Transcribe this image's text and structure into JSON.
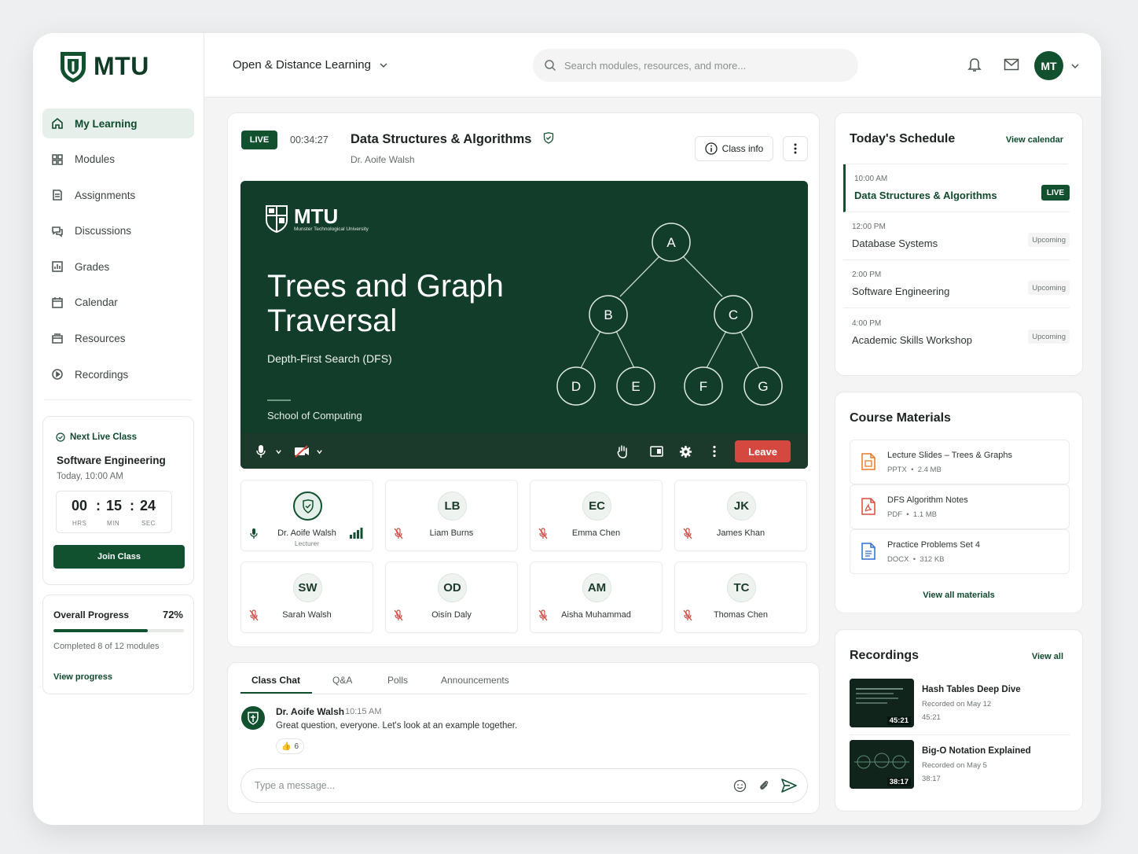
{
  "brand": {
    "name": "MTU"
  },
  "sidebar": {
    "items": [
      {
        "label": "My Learning",
        "icon": "home-icon"
      },
      {
        "label": "Modules",
        "icon": "grid-icon"
      },
      {
        "label": "Assignments",
        "icon": "assignment-icon"
      },
      {
        "label": "Discussions",
        "icon": "chat-bubbles-icon"
      },
      {
        "label": "Grades",
        "icon": "bar-chart-icon"
      },
      {
        "label": "Calendar",
        "icon": "calendar-icon"
      },
      {
        "label": "Resources",
        "icon": "folder-icon"
      },
      {
        "label": "Recordings",
        "icon": "play-circle-icon"
      }
    ],
    "next_live_class": {
      "heading": "Next Live Class",
      "title": "Software Engineering",
      "time": "Today, 10:00 AM",
      "countdown": {
        "hrs": "00",
        "min": "15",
        "sec": "24",
        "hrs_label": "HRS",
        "min_label": "MIN",
        "sec_label": "SEC"
      },
      "join_label": "Join Class"
    },
    "progress": {
      "title": "Overall Progress",
      "percent_label": "72%",
      "percent": 72,
      "subtitle": "Completed 8 of 12 modules",
      "link": "View progress"
    }
  },
  "header": {
    "program": "Open & Distance Learning",
    "search_placeholder": "Search modules, resources, and more...",
    "avatar_initials": "MT"
  },
  "session": {
    "live_badge": "LIVE",
    "elapsed": "00:34:27",
    "course_title": "Data Structures & Algorithms",
    "lecturer": "Dr. Aoife Walsh",
    "class_info_label": "Class info",
    "slide": {
      "logo_text": "MTU",
      "logo_subtext": "Munster Technological University",
      "title": "Trees and Graph Traversal",
      "subtitle": "Depth-First Search (DFS)",
      "footer": "School of Computing",
      "nodes": [
        "A",
        "B",
        "C",
        "D",
        "E",
        "F",
        "G"
      ]
    },
    "leave_label": "Leave",
    "participants": [
      {
        "name": "Dr. Aoife Walsh",
        "role": "Lecturer",
        "initials": "",
        "muted": false,
        "host": true
      },
      {
        "name": "Liam Burns",
        "initials": "LB",
        "muted": true
      },
      {
        "name": "Emma Chen",
        "initials": "EC",
        "muted": true
      },
      {
        "name": "James Khan",
        "initials": "JK",
        "muted": true
      },
      {
        "name": "Sarah Walsh",
        "initials": "SW",
        "muted": true
      },
      {
        "name": "Oisín Daly",
        "initials": "OD",
        "muted": true
      },
      {
        "name": "Aisha Muhammad",
        "initials": "AM",
        "muted": true
      },
      {
        "name": "Thomas Chen",
        "initials": "TC",
        "muted": true
      }
    ]
  },
  "chat": {
    "tabs": [
      "Class Chat",
      "Q&A",
      "Polls",
      "Announcements"
    ],
    "message": {
      "author": "Dr. Aoife Walsh",
      "time": "10:15 AM",
      "text": "Great question, everyone. Let's look at an example together.",
      "reaction_count": "6"
    },
    "input_placeholder": "Type a message..."
  },
  "schedule": {
    "title": "Today's Schedule",
    "link": "View calendar",
    "items": [
      {
        "time": "10:00 AM",
        "name": "Data Structures & Algorithms",
        "status": "LIVE"
      },
      {
        "time": "12:00 PM",
        "name": "Database Systems",
        "status": "Upcoming"
      },
      {
        "time": "2:00 PM",
        "name": "Software Engineering",
        "status": "Upcoming"
      },
      {
        "time": "4:00 PM",
        "name": "Academic Skills Workshop",
        "status": "Upcoming"
      }
    ]
  },
  "materials": {
    "title": "Course Materials",
    "items": [
      {
        "name": "Lecture Slides – Trees & Graphs",
        "type": "PPTX",
        "size": "2.4 MB",
        "color": "#e8782a"
      },
      {
        "name": "DFS Algorithm Notes",
        "type": "PDF",
        "size": "1.1 MB",
        "color": "#d94a3d"
      },
      {
        "name": "Practice Problems Set 4",
        "type": "DOCX",
        "size": "312 KB",
        "color": "#2d6fd1"
      }
    ],
    "link": "View all materials"
  },
  "recordings": {
    "title": "Recordings",
    "link": "View all",
    "items": [
      {
        "name": "Hash Tables Deep Dive",
        "date": "Recorded on May 12",
        "duration": "45:21"
      },
      {
        "name": "Big-O Notation Explained",
        "date": "Recorded on May 5",
        "duration": "38:17"
      }
    ]
  },
  "colors": {
    "brand": "#11512f",
    "leave": "#d4483f"
  }
}
